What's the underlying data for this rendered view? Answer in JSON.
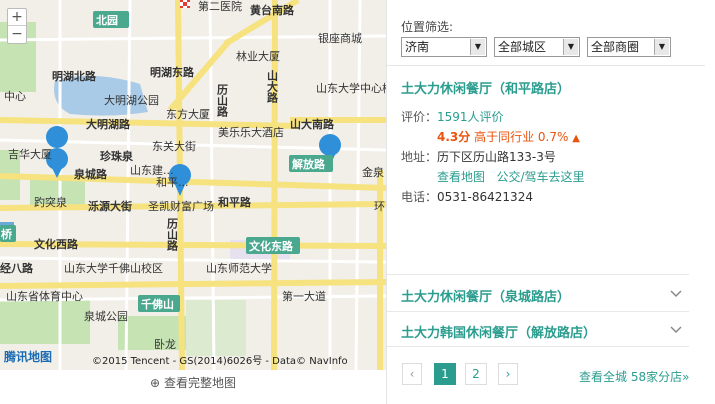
{
  "map": {
    "zoom_in": "+",
    "zoom_out": "−",
    "logo": "腾讯地图",
    "copyright": "©2015 Tencent - GS(2014)6026号 - Data© NavInfo",
    "view_full": "查看完整地图",
    "labels": {
      "beiyuan": "北园",
      "dier_yiyuan": "第二医院",
      "huangtaina": "黄台南路",
      "mingzhubei": "明湖北路",
      "mingzhudong": "明湖东路",
      "mingzhu_park": "大明湖公园",
      "daminghu": "大明湖路",
      "dongfang": "东方大厦",
      "dongguan": "东关大街",
      "lishan": "历山路",
      "linye": "林业大厦",
      "shanda_road": "山大路",
      "yinzuo": "银座商城",
      "shanda_school": "山东大学中心校区",
      "meile": "美乐乐大酒店",
      "shandananlu": "山大南路",
      "jiefanglu": "解放路",
      "jixiang": "吉华大厦",
      "zhenzhuquan": "珍珠泉",
      "quanchenglu": "泉城路",
      "shandongjian": "山东建...",
      "heping_text": "和平...",
      "shengkai": "圣凯财富广场",
      "qutu": "趵突泉",
      "luoyuan": "泺源大街",
      "hepinglu": "和平路",
      "lishanlu2": "历山路",
      "wenhuadong": "文化东路",
      "wenhuaxi": "文化西路",
      "jingsanlu": "经八路",
      "shanshida": "山东师范大学",
      "shanda_qfs": "山东大学千佛山校区",
      "shanda_jiaoyu": "山东省体育中心",
      "qianfoshan": "千佛山",
      "diyi": "第一大道",
      "quancheng_park": "泉城公园",
      "wolong": "卧龙",
      "jinzhu": "金泉",
      "huan": "环",
      "qiao": "桥",
      "zhong": "中心"
    }
  },
  "filter": {
    "label": "位置筛选:",
    "city": "济南",
    "district": "全部城区",
    "area": "全部商圈"
  },
  "shop": {
    "title": "土大力休闲餐厅（和平路店）",
    "rating_key": "评价：",
    "reviews": "1591人评价",
    "score": "4.3分",
    "compare": "高于同行业 0.7%",
    "address_key": "地址：",
    "address": "历下区历山路133-3号",
    "view_map": "查看地图",
    "route": "公交/驾车去这里",
    "phone_key": "电话：",
    "phone": "0531-86421324"
  },
  "other_shops": [
    {
      "title": "土大力休闲餐厅（泉城路店）"
    },
    {
      "title": "土大力韩国休闲餐厅（解放路店）"
    }
  ],
  "pagination": {
    "prev": "‹",
    "pages": [
      "1",
      "2"
    ],
    "next": "›",
    "all_link": "查看全城 58家分店»"
  },
  "colors": {
    "accent": "#2b9d8e",
    "score": "#e8540e",
    "marker": "#2f8fd8",
    "road_yellow": "#f6e27f",
    "water": "#a9cbe8",
    "green": "#c6e3b3"
  }
}
